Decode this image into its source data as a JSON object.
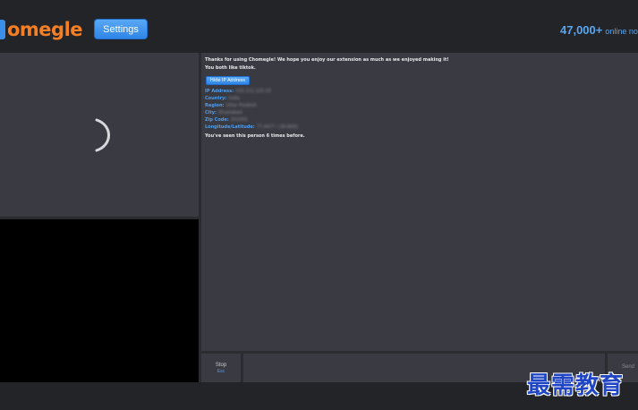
{
  "header": {
    "logo_text": "omegle",
    "settings_label": "Settings",
    "online_count": "47,000+",
    "online_text": "online no"
  },
  "chat": {
    "welcome": "Thanks for using Chomegle! We hope you enjoy our extension as much as we enjoyed making it!",
    "like_line": "You both like tiktok.",
    "hide_ip_label": "Hide IP Address",
    "info": [
      {
        "key": "IP Address:",
        "value": "103.111.125.25"
      },
      {
        "key": "Country:",
        "value": "India"
      },
      {
        "key": "Region:",
        "value": "Uttar Pradesh"
      },
      {
        "key": "City:",
        "value": "Ghaziabad"
      },
      {
        "key": "Zip Code:",
        "value": "201001"
      },
      {
        "key": "Longitude/Latitude:",
        "value": "77.4477 / 28.6692"
      }
    ],
    "seen_line": "You've seen this person 6 times before."
  },
  "controls": {
    "stop_label": "Stop",
    "stop_key": "Esc",
    "send_label": "Send"
  },
  "watermark": "最需教育",
  "colors": {
    "accent_blue": "#3b8fe8",
    "logo_orange": "#f47f24",
    "panel": "#3a3b42",
    "background": "#2b2c2f"
  }
}
